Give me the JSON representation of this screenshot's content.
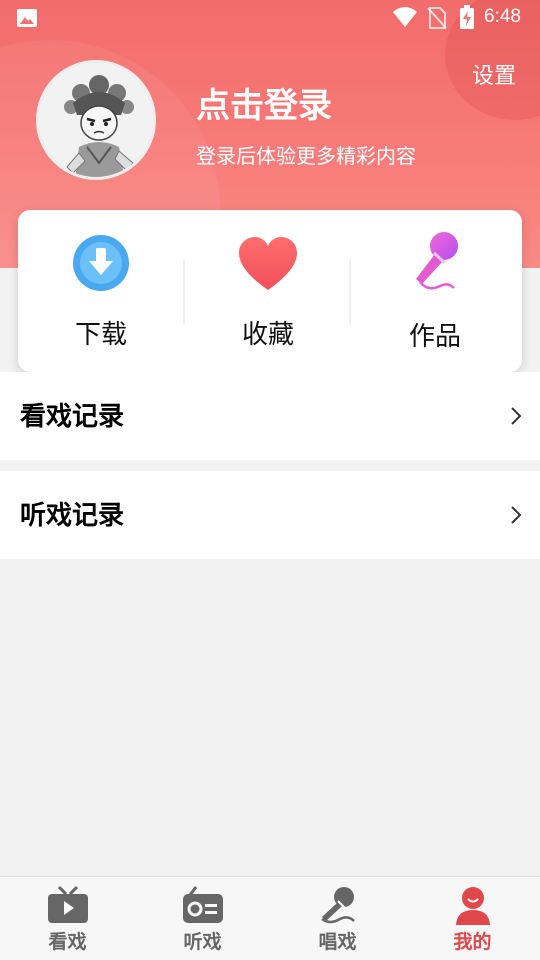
{
  "status_bar": {
    "time": "6:48",
    "icons": [
      "gallery-icon",
      "wifi-icon",
      "no-sim-icon",
      "battery-charging-icon"
    ]
  },
  "header": {
    "settings_label": "设置",
    "login_title": "点击登录",
    "login_subtitle": "登录后体验更多精彩内容",
    "avatar": "opera-character-avatar",
    "colors": {
      "gradient_top": "#f26c6c",
      "gradient_bottom": "#f98a86"
    }
  },
  "quick_actions": [
    {
      "label": "下载",
      "icon": "download-icon",
      "color": "#4aa8f0"
    },
    {
      "label": "收藏",
      "icon": "heart-icon",
      "color": "#f55a60"
    },
    {
      "label": "作品",
      "icon": "microphone-icon",
      "color": "#d84df0"
    }
  ],
  "records": [
    {
      "label": "看戏记录",
      "icon": "chevron-right-icon"
    },
    {
      "label": "听戏记录",
      "icon": "chevron-right-icon"
    }
  ],
  "bottom_nav": {
    "active": "我的",
    "active_color": "#e0474a",
    "items": [
      {
        "label": "看戏",
        "icon": "tv-icon"
      },
      {
        "label": "听戏",
        "icon": "radio-icon"
      },
      {
        "label": "唱戏",
        "icon": "microphone-icon"
      },
      {
        "label": "我的",
        "icon": "user-icon"
      }
    ]
  }
}
